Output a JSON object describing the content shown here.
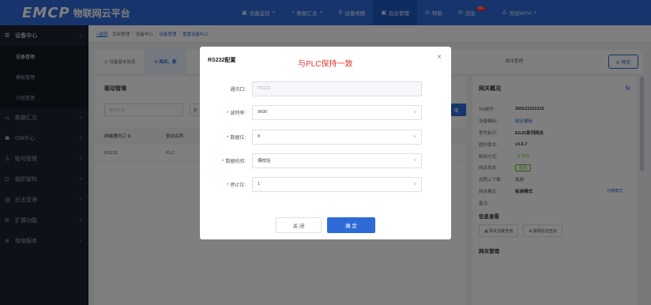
{
  "header": {
    "logo_mark": "EMCP",
    "brand": "物联网云平台",
    "nav": [
      {
        "icon": "▣",
        "label": "设备监控",
        "caret": true
      },
      {
        "icon": "◔",
        "label": "数据汇总",
        "caret": true
      },
      {
        "icon": "⚲",
        "label": "设备地图",
        "caret": false
      },
      {
        "icon": "▣",
        "label": "后台管理",
        "caret": false,
        "active": true
      },
      {
        "icon": "⊙",
        "label": "帮助",
        "caret": false
      },
      {
        "icon": "✉",
        "label": "消息",
        "caret": false,
        "badge": "99+"
      },
      {
        "icon": "♙",
        "label": "测试WYH",
        "caret": true
      }
    ]
  },
  "sidebar": {
    "items": [
      {
        "icon": "☰",
        "label": "设备中心",
        "open": true,
        "subs": [
          {
            "label": "设备管理",
            "active": true
          },
          {
            "label": "模板管理"
          },
          {
            "label": "分组管理"
          }
        ]
      },
      {
        "icon": "⚏",
        "label": "数据汇总"
      },
      {
        "icon": "☗",
        "label": "GM中心"
      },
      {
        "icon": "♙",
        "label": "账号管理"
      },
      {
        "icon": "⊡",
        "label": "组织架构"
      },
      {
        "icon": "▤",
        "label": "日志管理"
      },
      {
        "icon": "⊞",
        "label": "扩展功能"
      },
      {
        "icon": "⊕",
        "label": "增值服务"
      }
    ]
  },
  "breadcrumb": {
    "back": "返回",
    "items": [
      "后台管理",
      "设备中心",
      "设备管理",
      "重置设备PLC"
    ]
  },
  "tabs": [
    {
      "label": "◎ 设备基本信息",
      "active": false
    },
    {
      "label": "② 网关、数",
      "active": true
    }
  ],
  "tab_right": "脚本管理",
  "preview_label": "⊙ 预览",
  "driver_panel": {
    "title": "驱动管理",
    "search_placeholder": "通讯名称",
    "all_label": "全",
    "add_btn": "增",
    "columns": [
      "网端通讯口 ⇅",
      "驱动名称"
    ],
    "rows": [
      [
        "RS232",
        "PLC"
      ]
    ]
  },
  "gateway_panel": {
    "title": "网关概况",
    "rows": [
      {
        "k": "SN编号:",
        "v": "200121011016",
        "style": "bold"
      },
      {
        "k": "设备模板:",
        "v": "绑定模板",
        "style": "link"
      },
      {
        "k": "型号标识:",
        "v": "EG20系列网关",
        "style": "bold"
      },
      {
        "k": "固件版本:",
        "v": "v3.6.7",
        "style": "bold"
      },
      {
        "k": "联网方式:",
        "v": "..ıl 76%",
        "style": "green"
      },
      {
        "k": "网关状态:",
        "v": "在线",
        "style": "tag"
      },
      {
        "k": "远程上下载:",
        "v": "关闭",
        "style": "plain"
      },
      {
        "k": "网关模式:",
        "v": "标准模式",
        "style": "bold",
        "side": "切换模式"
      },
      {
        "k": "备注:",
        "v": "",
        "style": "plain"
      }
    ],
    "section_info": "信息查看",
    "info_buttons": [
      "▦ 网关流量查询",
      "⊕ 联网信息查询"
    ],
    "section_mgmt": "网关管理"
  },
  "modal": {
    "title": "RS232配置",
    "note": "与PLC保持一致",
    "close": "×",
    "fields": [
      {
        "label": "通讯口:",
        "value": "RS232",
        "required": false,
        "disabled": true,
        "select": false
      },
      {
        "label": "波特率:",
        "value": "9600",
        "required": true,
        "disabled": false,
        "select": true
      },
      {
        "label": "数据位:",
        "value": "8",
        "required": true,
        "disabled": false,
        "select": true
      },
      {
        "label": "数据校验:",
        "value": "偶校验",
        "required": true,
        "disabled": false,
        "select": true
      },
      {
        "label": "停止位:",
        "value": "1",
        "required": true,
        "disabled": false,
        "select": true
      }
    ],
    "cancel": "关 闭",
    "ok": "确 定"
  }
}
